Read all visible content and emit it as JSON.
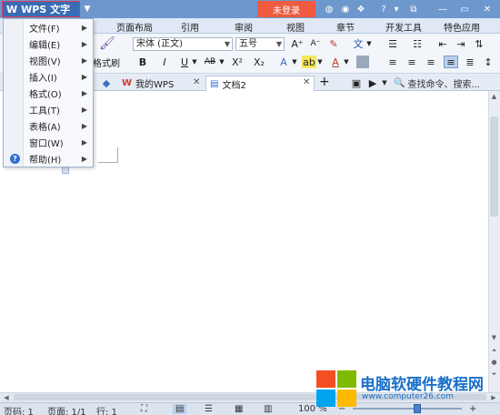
{
  "titlebar": {
    "app_name": "WPS 文字",
    "app_logo": "W",
    "login": "未登录",
    "icons": [
      "skin-icon",
      "cloud-icon",
      "settings-icon",
      "help-icon"
    ],
    "help_glyph": "?",
    "colors": {
      "bar": "#6e97cd",
      "app_button": "#3a6cb4",
      "login": "#ee5b3f"
    }
  },
  "ribbon_tabs": [
    "页面布局",
    "引用",
    "审阅",
    "视图",
    "章节",
    "开发工具",
    "特色应用"
  ],
  "ribbon": {
    "font_name": "宋体 (正文)",
    "font_size": "五号",
    "format_painter": "格式刷",
    "bold": "B",
    "italic": "I",
    "underline": "U",
    "strike": "AB",
    "superscript": "X²",
    "subscript": "X₂",
    "grow_font": "A⁺",
    "shrink_font": "A⁻",
    "pinyin": "文",
    "text_effect": "A",
    "highlight": "ab",
    "font_color": "A"
  },
  "doc_tabs": {
    "tab1": "我的WPS",
    "tab2": "文档2",
    "add": "+",
    "search": "查找命令、搜索..."
  },
  "menu": {
    "items": [
      {
        "label": "文件(F)"
      },
      {
        "label": "编辑(E)"
      },
      {
        "label": "视图(V)"
      },
      {
        "label": "插入(I)"
      },
      {
        "label": "格式(O)"
      },
      {
        "label": "工具(T)"
      },
      {
        "label": "表格(A)"
      },
      {
        "label": "窗口(W)"
      },
      {
        "label": "帮助(H)"
      }
    ]
  },
  "statusbar": {
    "page_code": "页码: 1",
    "pages": "页面: 1/1",
    "line": "行: 1",
    "zoom": "100 %",
    "zoom_level": 100
  },
  "watermark": {
    "title": "电脑软硬件教程网",
    "url": "www.computer26.com"
  }
}
